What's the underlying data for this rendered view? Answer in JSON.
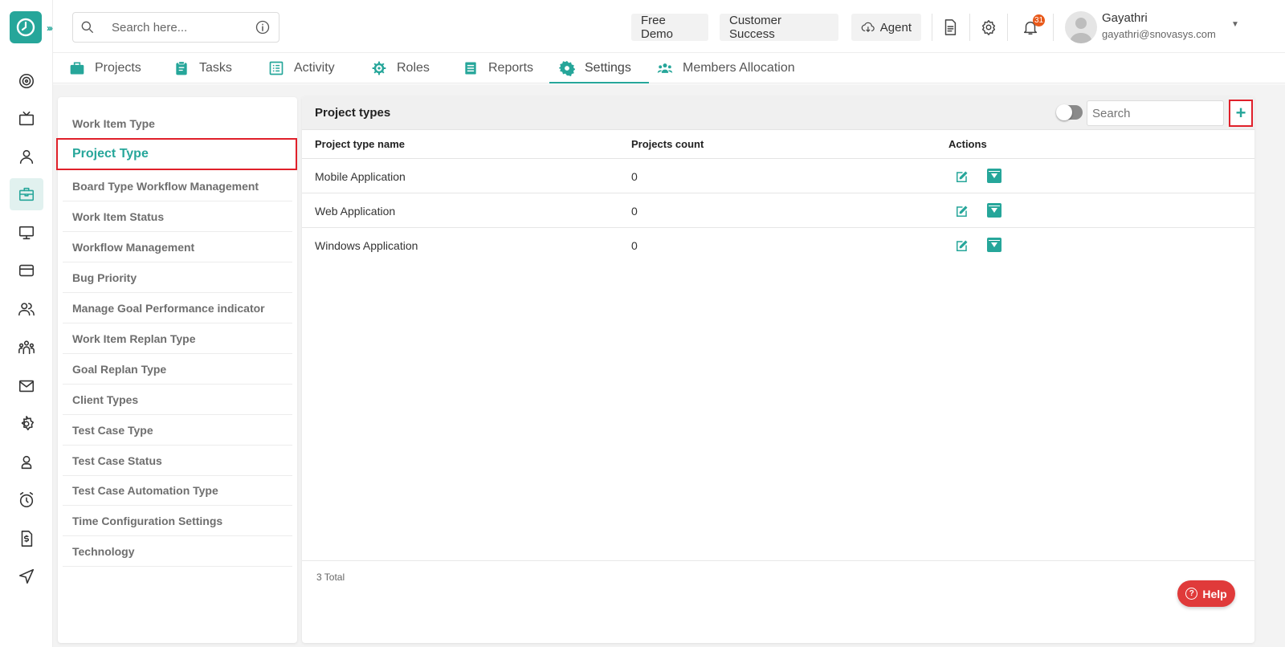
{
  "header": {
    "search_placeholder": "Search here...",
    "buttons": {
      "free_demo": "Free Demo",
      "customer_success": "Customer Success",
      "agent": "Agent"
    },
    "notification_count": "31",
    "user": {
      "name": "Gayathri",
      "email": "gayathri@snovasys.com"
    }
  },
  "nav_tabs": [
    {
      "label": "Projects",
      "icon": "briefcase-icon"
    },
    {
      "label": "Tasks",
      "icon": "clipboard-icon"
    },
    {
      "label": "Activity",
      "icon": "list-icon"
    },
    {
      "label": "Roles",
      "icon": "gear-icon"
    },
    {
      "label": "Reports",
      "icon": "report-icon"
    },
    {
      "label": "Settings",
      "icon": "gear-icon",
      "active": true
    },
    {
      "label": "Members Allocation",
      "icon": "users-icon"
    }
  ],
  "settings_menu": [
    {
      "label": "Work Item Type"
    },
    {
      "label": "Project Type",
      "active": true
    },
    {
      "label": "Board Type Workflow Management"
    },
    {
      "label": "Work Item Status"
    },
    {
      "label": "Workflow Management"
    },
    {
      "label": "Bug Priority"
    },
    {
      "label": "Manage Goal Performance indicator"
    },
    {
      "label": "Work Item Replan Type"
    },
    {
      "label": "Goal Replan Type"
    },
    {
      "label": "Client Types"
    },
    {
      "label": "Test Case Type"
    },
    {
      "label": "Test Case Status"
    },
    {
      "label": "Test Case Automation Type"
    },
    {
      "label": "Time Configuration Settings"
    },
    {
      "label": "Technology"
    }
  ],
  "panel": {
    "title": "Project types",
    "search_placeholder": "Search",
    "add_label": "+",
    "columns": [
      "Project type name",
      "Projects count",
      "Actions"
    ],
    "rows": [
      {
        "name": "Mobile Application",
        "count": "0"
      },
      {
        "name": "Web Application",
        "count": "0"
      },
      {
        "name": "Windows Application",
        "count": "0"
      }
    ],
    "total": "3 Total"
  },
  "help": {
    "label": "Help"
  },
  "colors": {
    "accent": "#26a69a",
    "highlight": "#e0202a",
    "help": "#e03a3a",
    "badge": "#e8591a"
  }
}
